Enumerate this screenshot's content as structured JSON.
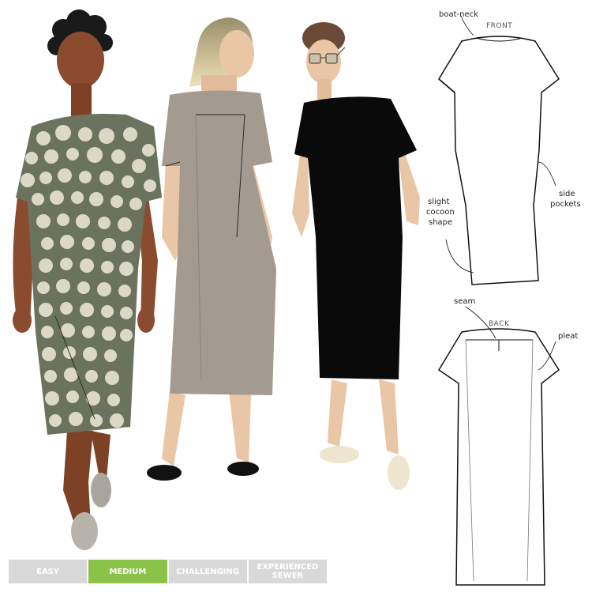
{
  "annotations": {
    "boat_neck": "boat-neck",
    "front": "FRONT",
    "side_pockets_1": "side",
    "side_pockets_2": "pockets",
    "cocoon_1": "slight",
    "cocoon_2": "cocoon",
    "cocoon_3": "shape",
    "seam": "seam",
    "back": "BACK",
    "pleat": "pleat"
  },
  "difficulty": {
    "levels": [
      {
        "label": "EASY",
        "active": false
      },
      {
        "label": "MEDIUM",
        "active": true
      },
      {
        "label": "CHALLENGING",
        "active": false
      },
      {
        "label": "EXPERIENCED SEWER",
        "active": false
      }
    ],
    "active_color": "#8bc34a",
    "inactive_color": "#d9d9d9"
  },
  "colors": {
    "print_dress": "#6b735f",
    "print_dots": "#dcd8c8",
    "linen_dress": "#a39b8f",
    "black_dress": "#0a0a0a",
    "skin_dark": "#8a4b2e",
    "skin_light": "#e8c6a6"
  }
}
